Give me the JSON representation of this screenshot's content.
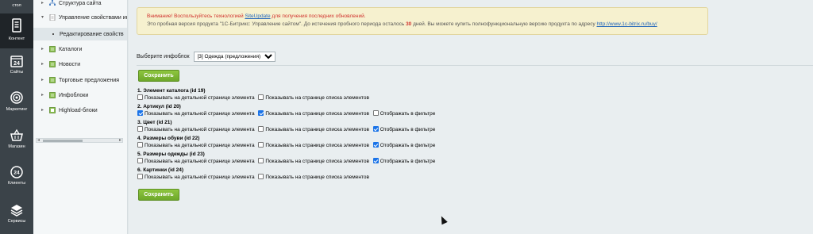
{
  "leftnav": {
    "items": [
      {
        "label": "стол",
        "icon": "desktop-icon",
        "active": false
      },
      {
        "label": "Контент",
        "icon": "content-icon",
        "active": true
      },
      {
        "label": "Сайты",
        "icon": "calendar-24-icon",
        "active": false
      },
      {
        "label": "Маркетинг",
        "icon": "target-icon",
        "active": false
      },
      {
        "label": "Магазин",
        "icon": "basket-icon",
        "active": false
      },
      {
        "label": "Клиенты",
        "icon": "clients-24-icon",
        "active": false
      },
      {
        "label": "Сервисы",
        "icon": "layers-icon",
        "active": false
      }
    ]
  },
  "tree": {
    "items": [
      {
        "label": "Структура сайта",
        "icon": "sitemap-icon"
      },
      {
        "label": "Управление свойствами ин",
        "icon": "doc-icon"
      },
      {
        "label": "Редактирование свойств",
        "icon": "dot"
      },
      {
        "label": "Каталоги",
        "icon": "iblock-icon"
      },
      {
        "label": "Новости",
        "icon": "iblock-icon"
      },
      {
        "label": "Торговые предложения",
        "icon": "iblock-icon"
      },
      {
        "label": "Инфоблоки",
        "icon": "iblock-icon"
      },
      {
        "label": "Highload-блоки",
        "icon": "hlblock-icon"
      }
    ]
  },
  "notice": {
    "pre": "Внимание! Воспользуйтесь технологией ",
    "link": "SiteUpdate",
    "post": " для получения последних обновлений.",
    "trial_pre": "Это пробная версия продукта \"1С-Битрикс: Управление сайтом\". До истечения пробного периода осталось ",
    "trial_days": "30",
    "trial_mid": " дней. Вы можете купить полнофункциональную версию продукта по адресу ",
    "trial_link": "http://www.1c-bitrix.ru/buy/"
  },
  "infoblock": {
    "label": "Выберите инфоблок",
    "selected": "[3] Одежда (предложения)"
  },
  "buttons": {
    "save_top": "Сохранить",
    "save_bottom": "Сохранить"
  },
  "option_labels": {
    "detail": "Показывать на детальной странице элемента",
    "list": "Показывать на странице списка элементов",
    "filter": "Отображать в фильтре"
  },
  "properties": [
    {
      "title": "1. Элемент каталога (id 19)",
      "detail": false,
      "list": false,
      "filter": null
    },
    {
      "title": "2. Артикул (id 20)",
      "detail": true,
      "list": true,
      "filter": false
    },
    {
      "title": "3. Цвет (id 21)",
      "detail": false,
      "list": false,
      "filter": true
    },
    {
      "title": "4. Размеры обуви (id 22)",
      "detail": false,
      "list": false,
      "filter": true
    },
    {
      "title": "5. Размеры одежды (id 23)",
      "detail": false,
      "list": false,
      "filter": true
    },
    {
      "title": "6. Картинки (id 24)",
      "detail": false,
      "list": false,
      "filter": null
    }
  ],
  "colors": {
    "accent_green": "#7ab635",
    "checkbox_blue": "#1a73e8",
    "warning_red": "#d0312d"
  }
}
